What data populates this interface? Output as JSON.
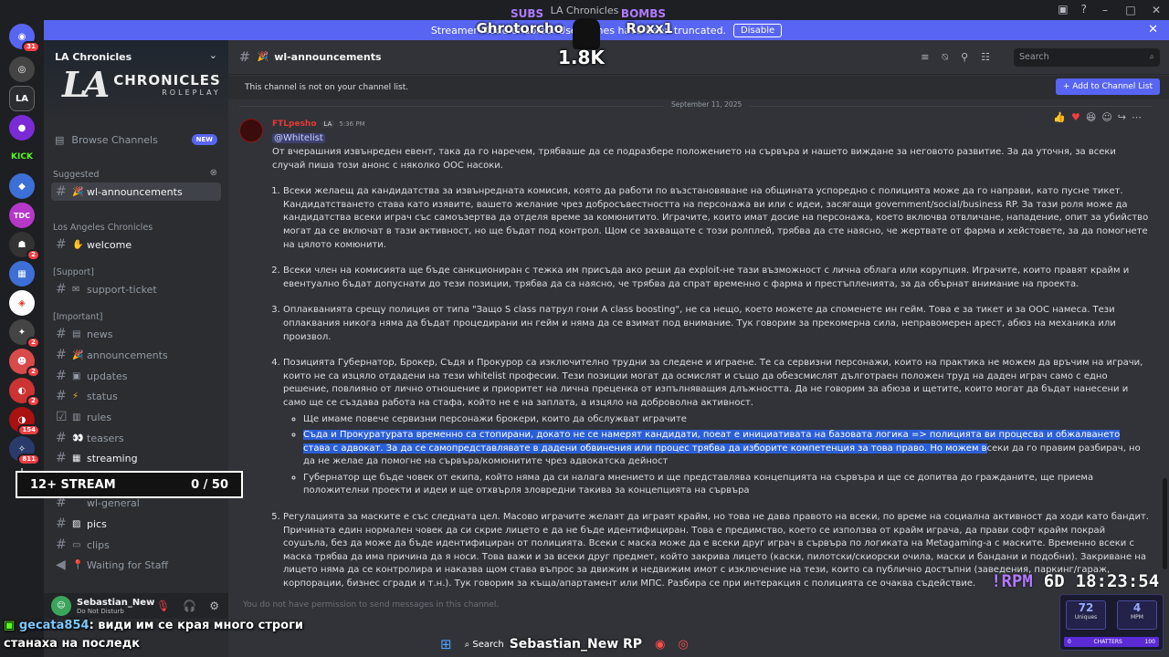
{
  "window": {
    "title": "LA Chronicles"
  },
  "banner": {
    "text": "Streamer Mode enabled. Usernames have been truncated.",
    "button": "Disable"
  },
  "overlay": {
    "subs_label": "SUBS",
    "bombs_label": "BOMBS",
    "name_left": "Ghrotorcho",
    "name_right": "Roxx1",
    "count": "1.8K"
  },
  "guilds": {
    "badges": [
      "31",
      "2",
      "2",
      "2",
      "2",
      "154",
      "811"
    ]
  },
  "server": {
    "name": "LA Chronicles",
    "logo_main": "CHRONICLES",
    "logo_sub": "ROLEPLAY",
    "browse": "Browse Channels",
    "new_badge": "NEW",
    "suggested_label": "Suggested",
    "suggested_channel": "wl-announcements",
    "cat1": "Los Angeles Chronicles",
    "welcome": "welcome",
    "cat2": "[Support]",
    "support": "support-ticket",
    "cat3": "[Important]",
    "important": [
      "news",
      "announcements",
      "updates",
      "status",
      "rules",
      "teasers",
      "streaming"
    ],
    "general": "wl-general",
    "pics": "pics",
    "clips": "clips",
    "waiting": "Waiting for Staff"
  },
  "stream_box": {
    "label": "12+ STREAM",
    "value": "0 / 50"
  },
  "user": {
    "name": "Sebastian_New",
    "status": "Do Not Disturb"
  },
  "chat": {
    "channel": "wl-announcements",
    "search_placeholder": "Search",
    "notice": "This channel is not on your channel list.",
    "add_button": "Add to Channel List",
    "date": "September 11, 2025",
    "author": "FTLpesho",
    "author_tag": "LA",
    "time": "5:36 PM",
    "mention": "@Whitelist",
    "intro": "От вчерашния извънреден евент, така да го наречем, трябваше да се подразбере положението на сървъра и нашето виждане за неговото развитие. За да уточня, за всеки случай пиша този анонс с няколко ООС насоки.",
    "items": [
      "Всеки желаещ да кандидатства за извънредната комисия, която да работи по възстановяване на общината успоредно с полицията може да го направи, като пусне тикет. Кандидатстването става като изявите, вашето желание чрез добросъвестността на персонажа ви или с идеи, засягащи government/social/business  RP. За тази роля може да кандидатства всеки играч със самоъзертва да отделя време за комюнитито. Играчите, които имат досие на персонажа, което включва отвличане, нападение, опит за убийство могат да се включат в тази активност, но ще бъдат под контрол. Щом се захващате с този ролплей, трябва да сте наясно, че жертвате от фарма и хейстовете, за да помогнете на цялото комюнити.",
      "Всеки член на комисията ще бъде санкциониран с тежка им присъда ако реши да exploit-не тази възможност с лична облага или корупция. Играчите, които правят крайм и евентуално бъдат допуснати до тези позиции, трябва да са наясно, че трябва да спрат временно с фарма и престъпленията, за да обърнат внимание на проекта.",
      "Оплакванията срещу полиция от типа \"Защо S class патрул гони A class boosting\", не са нещо, което можете да споменете ин гейм. Това е за тикет и за ООС намеса. Тези оплаквания никога няма да бъдат процедирани ин гейм и няма да се взимат под внимание. Тук говорим за прекомерна сила, неправомерен арест, абюз на механика или произвол.",
      "Позицията Губернатор, Брокер, Съдя и Прокурор са изключително трудни за следене и играене. Те са сервизни персонажи, които на практика не можем да връчим на играчи, които не са изцяло отдадени на тези whitelist професии. Тези позиции могат да осмислят и също да обезсмислят дълготраен положен труд на даден играч само с едно решение, повлияно от лично отношение и приоритет на лична преценка от изпълняващия длъжността. Да не говорим за абюза и щетите, които могат да бъдат нанесени и само ще се създава работа на стафа, който не е на заплата, а изцяло на доброволна активност."
    ],
    "sub1": "Ще имаме повече сервизни персонажи брокери, които да обслужват играчите",
    "sub2_highlight": "Съда и Прокуратурата временно са стопирани, докато не се намерят кандидати, поеат е инициативата на базовата логика => полицията ви процесва и обжалването става с адвокат. За да се самопредставлявате в дадени обвинения или процес трябва да изборите компетенция за това право. Но можем в",
    "sub2_rest": "секи да го правим разбирач, но да не желае да помогне на сървъра/комюнитите чрез адвокатска дейност",
    "sub3": "Губернатор ще бъде човек от екипа, който няма да си налага мнението и ще представлява концепцията на сървъра и ще се допитва до гражданите, ще приема положителни проекти и идеи и ще отхвърля зловредни такива за концепцията на сървъра",
    "item5": "Регулацията за маските е със следната цел. Масово играчите желаят да играят крайм, но това не дава правото на всеки, по време на социална активност да ходи като бандит. Причината един нормален човек да си скрие лицето е да не бъде идентифициран. Това е предимство, което се използва от крайм играча, да прави софт крайм покрай соушъла, без да може да бъде идентифициран от полицията. Всеки с маска може да е всеки друг играч в сървъра по логиката на Metagaming-а с маските. Временно всеки с маска трябва да има причина да я носи. Това важи и за всеки друг предмет, който закрива лицето (каски, пилотски/скиорски очила, маски и бандани и подобни). Закриване на лицето няма да се контролира и наказва щом става въпрос за движим и недвижим имот с изключение на тези, които са публично достъпни (заведения, паркинг/гараж, корпорации, бизнес сгради и т.н.). Тук говорим за къща/апартамент или МПС. Разбира се при интеракция с полицията се очаква съдействие.",
    "composer": "You do not have permission to send messages in this channel."
  },
  "stream_hud": {
    "rpm": "!RPM",
    "days": "6D",
    "time": "18:23:54",
    "uniques_value": "72",
    "uniques_label": "Uniques",
    "mpm_value": "4",
    "mpm_label": "MPM",
    "chatters_min": "0",
    "chatters_label": "CHATTERS",
    "chatters_max": "100"
  },
  "stream_chat": {
    "user": "gecata854",
    "line1": ": види им се края много строги",
    "line2": "станаха на последк"
  },
  "taskbar": {
    "search": "Search",
    "streamer": "Sebastian_New RP"
  }
}
